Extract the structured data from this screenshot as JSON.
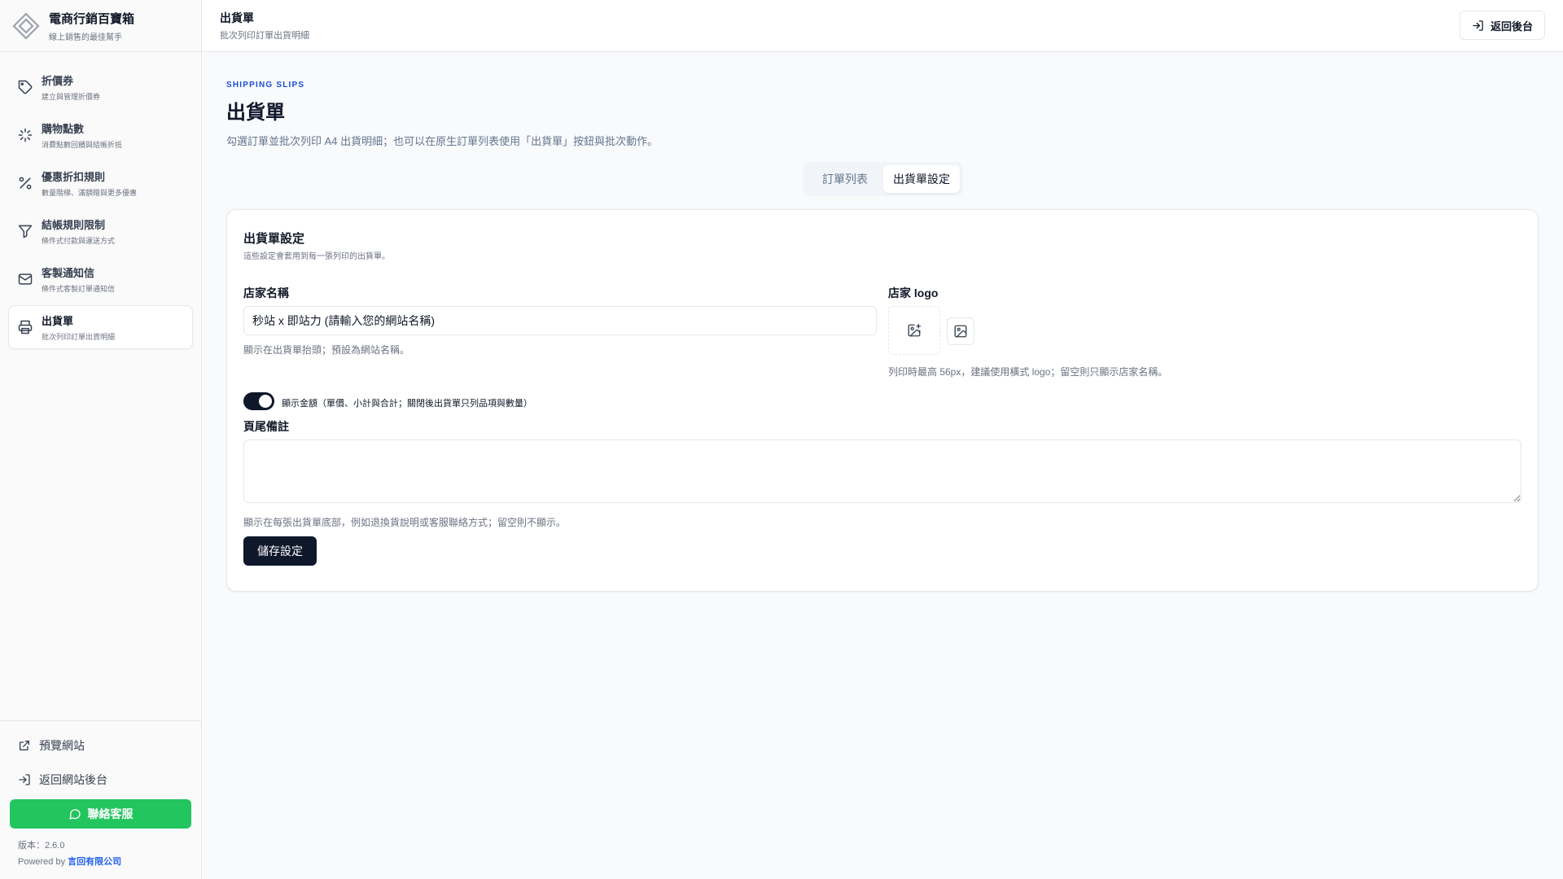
{
  "brand": {
    "title": "電商行銷百寶箱",
    "subtitle": "線上銷售的最佳幫手",
    "logo_icon": "diamond-logo-icon"
  },
  "sidebar": {
    "items": [
      {
        "title": "折價券",
        "desc": "建立與管理折價券",
        "icon": "tag-icon"
      },
      {
        "title": "購物點數",
        "desc": "消費點數回饋與結帳折抵",
        "icon": "sparkle-icon"
      },
      {
        "title": "優惠折扣規則",
        "desc": "數量階梯、滿額贈與更多優惠",
        "icon": "percent-icon"
      },
      {
        "title": "結帳規則限制",
        "desc": "條件式付款與運送方式",
        "icon": "filter-icon"
      },
      {
        "title": "客製通知信",
        "desc": "條件式客製訂單通知信",
        "icon": "mail-icon"
      },
      {
        "title": "出貨單",
        "desc": "批次列印訂單出貨明細",
        "icon": "printer-icon",
        "active": true
      }
    ],
    "preview_site": "預覽網站",
    "back_to_admin": "返回網站後台",
    "contact": "聯絡客服",
    "version": "版本：2.6.0",
    "powered_prefix": "Powered by ",
    "powered_company": "言回有限公司"
  },
  "header": {
    "title": "出貨單",
    "subtitle": "批次列印訂單出貨明細",
    "back_button": "返回後台"
  },
  "main": {
    "eyebrow": "SHIPPING SLIPS",
    "title": "出貨單",
    "description": "勾選訂單並批次列印 A4 出貨明細；也可以在原生訂單列表使用「出貨單」按鈕與批次動作。",
    "tabs": [
      {
        "label": "訂單列表",
        "active": false
      },
      {
        "label": "出貨單設定",
        "active": true
      }
    ]
  },
  "settings": {
    "title": "出貨單設定",
    "description": "這些設定會套用到每一張列印的出貨單。",
    "store_name_label": "店家名稱",
    "store_name_value": "秒站 x 即站力 (請輸入您的網站名稱)",
    "store_name_help": "顯示在出貨單抬頭；預設為網站名稱。",
    "logo_label": "店家 logo",
    "logo_help": "列印時最高 56px，建議使用橫式 logo；留空則只顯示店家名稱。",
    "show_amount_toggle": true,
    "show_amount_label": "顯示金額（單價、小計與合計；關閉後出貨單只列品項與數量）",
    "footer_note_label": "頁尾備註",
    "footer_note_value": "",
    "footer_note_help": "顯示在每張出貨單底部，例如退換貨說明或客服聯絡方式；留空則不顯示。",
    "save_button": "儲存設定"
  }
}
